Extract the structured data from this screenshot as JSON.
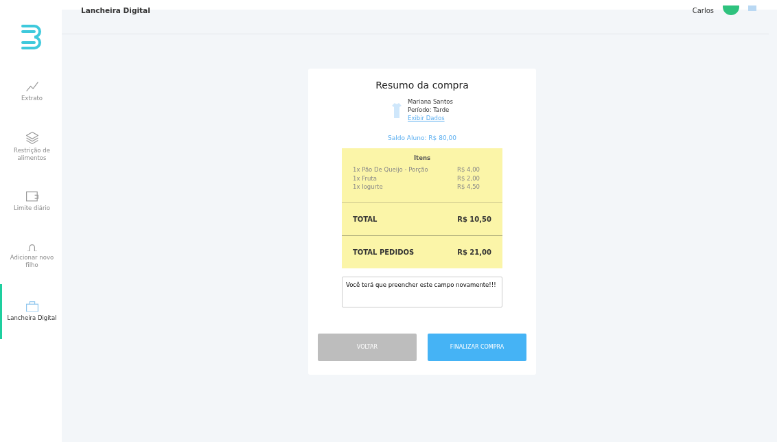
{
  "header": {
    "title": "Lancheira Digital",
    "user": "Carlos"
  },
  "sidebar": {
    "items": [
      {
        "label": "Extrato",
        "selected": false
      },
      {
        "label": "Restrição de alimentos",
        "selected": false
      },
      {
        "label": "Limite diário",
        "selected": false
      },
      {
        "label": "Adicionar novo filho",
        "selected": false
      },
      {
        "label": "Lancheira Digital",
        "selected": true
      }
    ]
  },
  "summary": {
    "title": "Resumo da compra",
    "student": {
      "name": "Mariana Santos",
      "period": "Período: Tarde",
      "link": "Exibir Dados"
    },
    "balance": "Saldo Aluno: R$ 80,00",
    "items_title": "Itens",
    "items": [
      {
        "name": "1x Pão De Queijo - Porção",
        "price": "R$ 4,00"
      },
      {
        "name": "1x Fruta",
        "price": "R$ 2,00"
      },
      {
        "name": "1x Iogurte",
        "price": "R$ 4,50"
      }
    ],
    "totals": [
      {
        "label": "TOTAL",
        "value": "R$ 10,50"
      },
      {
        "label": "TOTAL PEDIDOS",
        "value": "R$ 21,00"
      }
    ],
    "note": "Você terá que preencher este campo novamente!!!",
    "buttons": [
      {
        "label": "VOLTAR",
        "kind": "secondary"
      },
      {
        "label": "FINALIZAR COMPRA",
        "kind": "primary"
      }
    ]
  }
}
